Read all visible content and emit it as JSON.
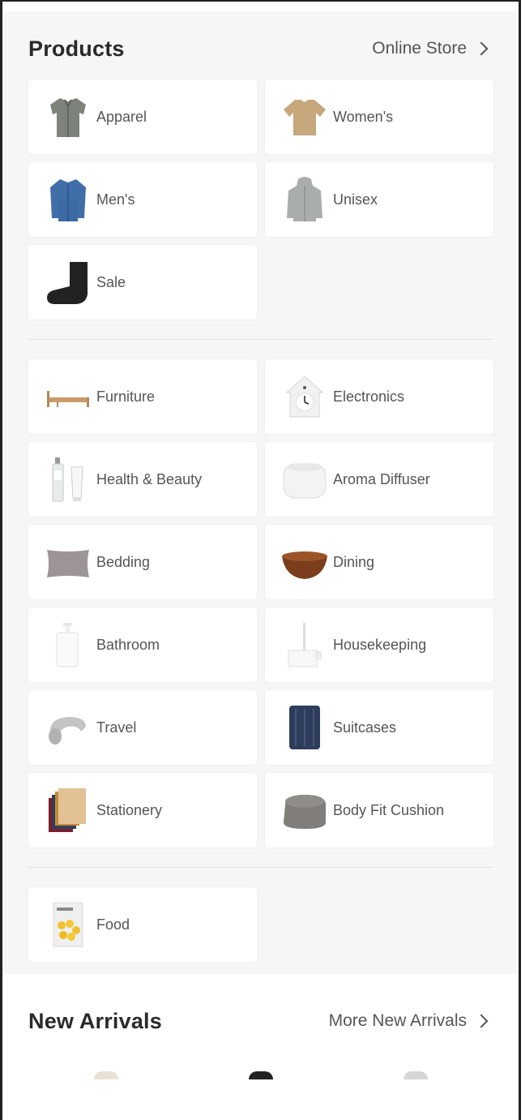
{
  "products": {
    "title": "Products",
    "link_label": "Online Store",
    "group1": [
      {
        "label": "Apparel",
        "icon": "shirt-icon"
      },
      {
        "label": "Women's",
        "icon": "tshirt-icon"
      },
      {
        "label": "Men's",
        "icon": "denim-shirt-icon"
      },
      {
        "label": "Unisex",
        "icon": "hoodie-icon"
      },
      {
        "label": "Sale",
        "icon": "sock-icon"
      }
    ],
    "group2": [
      {
        "label": "Furniture",
        "icon": "bed-icon"
      },
      {
        "label": "Electronics",
        "icon": "clock-icon"
      },
      {
        "label": "Health & Beauty",
        "icon": "bottles-icon"
      },
      {
        "label": "Aroma Diffuser",
        "icon": "diffuser-icon"
      },
      {
        "label": "Bedding",
        "icon": "pillow-icon"
      },
      {
        "label": "Dining",
        "icon": "bowl-icon"
      },
      {
        "label": "Bathroom",
        "icon": "dispenser-icon"
      },
      {
        "label": "Housekeeping",
        "icon": "lint-roller-icon"
      },
      {
        "label": "Travel",
        "icon": "neck-pillow-icon"
      },
      {
        "label": "Suitcases",
        "icon": "suitcase-icon"
      },
      {
        "label": "Stationery",
        "icon": "notebooks-icon"
      },
      {
        "label": "Body Fit Cushion",
        "icon": "beanbag-icon"
      }
    ],
    "group3": [
      {
        "label": "Food",
        "icon": "snack-bag-icon"
      }
    ]
  },
  "arrivals": {
    "title": "New Arrivals",
    "link_label": "More New Arrivals"
  }
}
